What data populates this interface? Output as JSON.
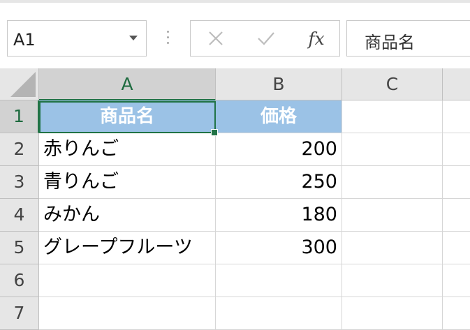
{
  "name_box": {
    "value": "A1"
  },
  "formula_bar": {
    "cancel_icon": "✕",
    "enter_icon": "✓",
    "fx_label": "fx",
    "content": "商品名"
  },
  "columns": [
    {
      "label": "A"
    },
    {
      "label": "B"
    },
    {
      "label": "C"
    }
  ],
  "rows": [
    {
      "label": "1"
    },
    {
      "label": "2"
    },
    {
      "label": "3"
    },
    {
      "label": "4"
    },
    {
      "label": "5"
    },
    {
      "label": "6"
    },
    {
      "label": "7"
    }
  ],
  "cells": {
    "A1": "商品名",
    "B1": "価格",
    "A2": "赤りんご",
    "B2": "200",
    "A3": "青りんご",
    "B3": "250",
    "A4": "みかん",
    "B4": "180",
    "A5": "グレープフルーツ",
    "B5": "300"
  },
  "selected_cell": "A1",
  "colors": {
    "header_fill": "#9bc2e6",
    "header_text": "#ffffff",
    "selection": "#217346"
  }
}
